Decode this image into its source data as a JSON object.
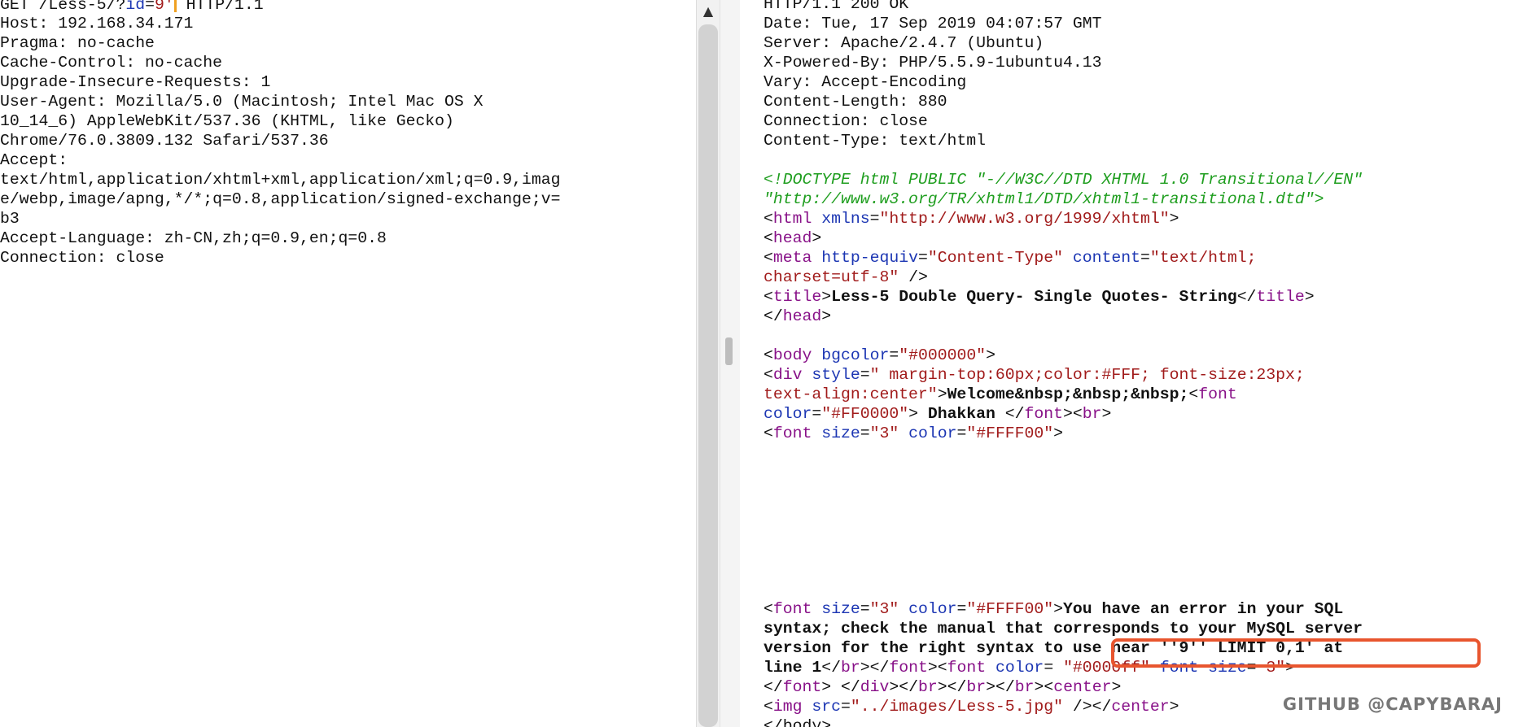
{
  "request": {
    "request_line": {
      "method": "GET",
      "path": "/Less-5/?",
      "param_key": "id",
      "eq": "=",
      "param_value": "9'",
      "version": "HTTP/1.1"
    },
    "lines": [
      "Host: 192.168.34.171",
      "Pragma: no-cache",
      "Cache-Control: no-cache",
      "Upgrade-Insecure-Requests: 1",
      "User-Agent: Mozilla/5.0 (Macintosh; Intel Mac OS X",
      "10_14_6) AppleWebKit/537.36 (KHTML, like Gecko)",
      "Chrome/76.0.3809.132 Safari/537.36",
      "Accept:",
      "text/html,application/xhtml+xml,application/xml;q=0.9,imag",
      "e/webp,image/apng,*/*;q=0.8,application/signed-exchange;v=",
      "b3",
      "Accept-Language: zh-CN,zh;q=0.9,en;q=0.8",
      "Connection: close"
    ]
  },
  "response": {
    "headers": [
      "HTTP/1.1 200 OK",
      "Date: Tue, 17 Sep 2019 04:07:57 GMT",
      "Server: Apache/2.4.7 (Ubuntu)",
      "X-Powered-By: PHP/5.5.9-1ubuntu4.13",
      "Vary: Accept-Encoding",
      "Content-Length: 880",
      "Connection: close",
      "Content-Type: text/html"
    ],
    "doctype_1": "<!DOCTYPE html PUBLIC \"-//W3C//DTD XHTML 1.0 Transitional//EN\"",
    "doctype_2": "\"http://www.w3.org/TR/xhtml1/DTD/xhtml1-transitional.dtd\">",
    "html_xmlns_value": "\"http://www.w3.org/1999/xhtml\"",
    "meta_equiv_value": "\"Content-Type\"",
    "meta_content_value": "\"text/html;",
    "meta_charset_line": "charset=utf-8\"",
    "title_text": "Less-5 Double Query- Single Quotes- String",
    "body_bgcolor": "\"#000000\"",
    "div_style_1": "\" margin-top:60px;color:#FFF; font-size:23px;",
    "div_style_2": "text-align:center\"",
    "welcome_text": "Welcome&nbsp;&nbsp;&nbsp;",
    "font_color_red": "\"#FF0000\"",
    "dhakkan_text": " Dhakkan ",
    "font_size_3": "\"3\"",
    "font_color_yellow": "\"#FFFF00\"",
    "error_1": "You have an error in your SQL",
    "error_2": "syntax; check the manual that corresponds to your MySQL server",
    "error_3": "version for the right syntax to use near ''9'' LIMIT 0,1' at",
    "error_4": "line 1",
    "font_color_blue": "\"#0000ff\"",
    "font_size_3b": "3\"",
    "img_src": "\"../images/Less-5.jpg\"",
    "last_partial": "</body>"
  },
  "scrollbar": {
    "up_arrow": "▲"
  },
  "watermark": "GITHUB @CAPYBARAJ",
  "colors": {
    "highlight": "#e8552e",
    "comment": "#1f9e1f",
    "tag": "#881188",
    "attr": "#1c36b3",
    "value": "#a11b1b",
    "cursor": "#f0a020"
  }
}
